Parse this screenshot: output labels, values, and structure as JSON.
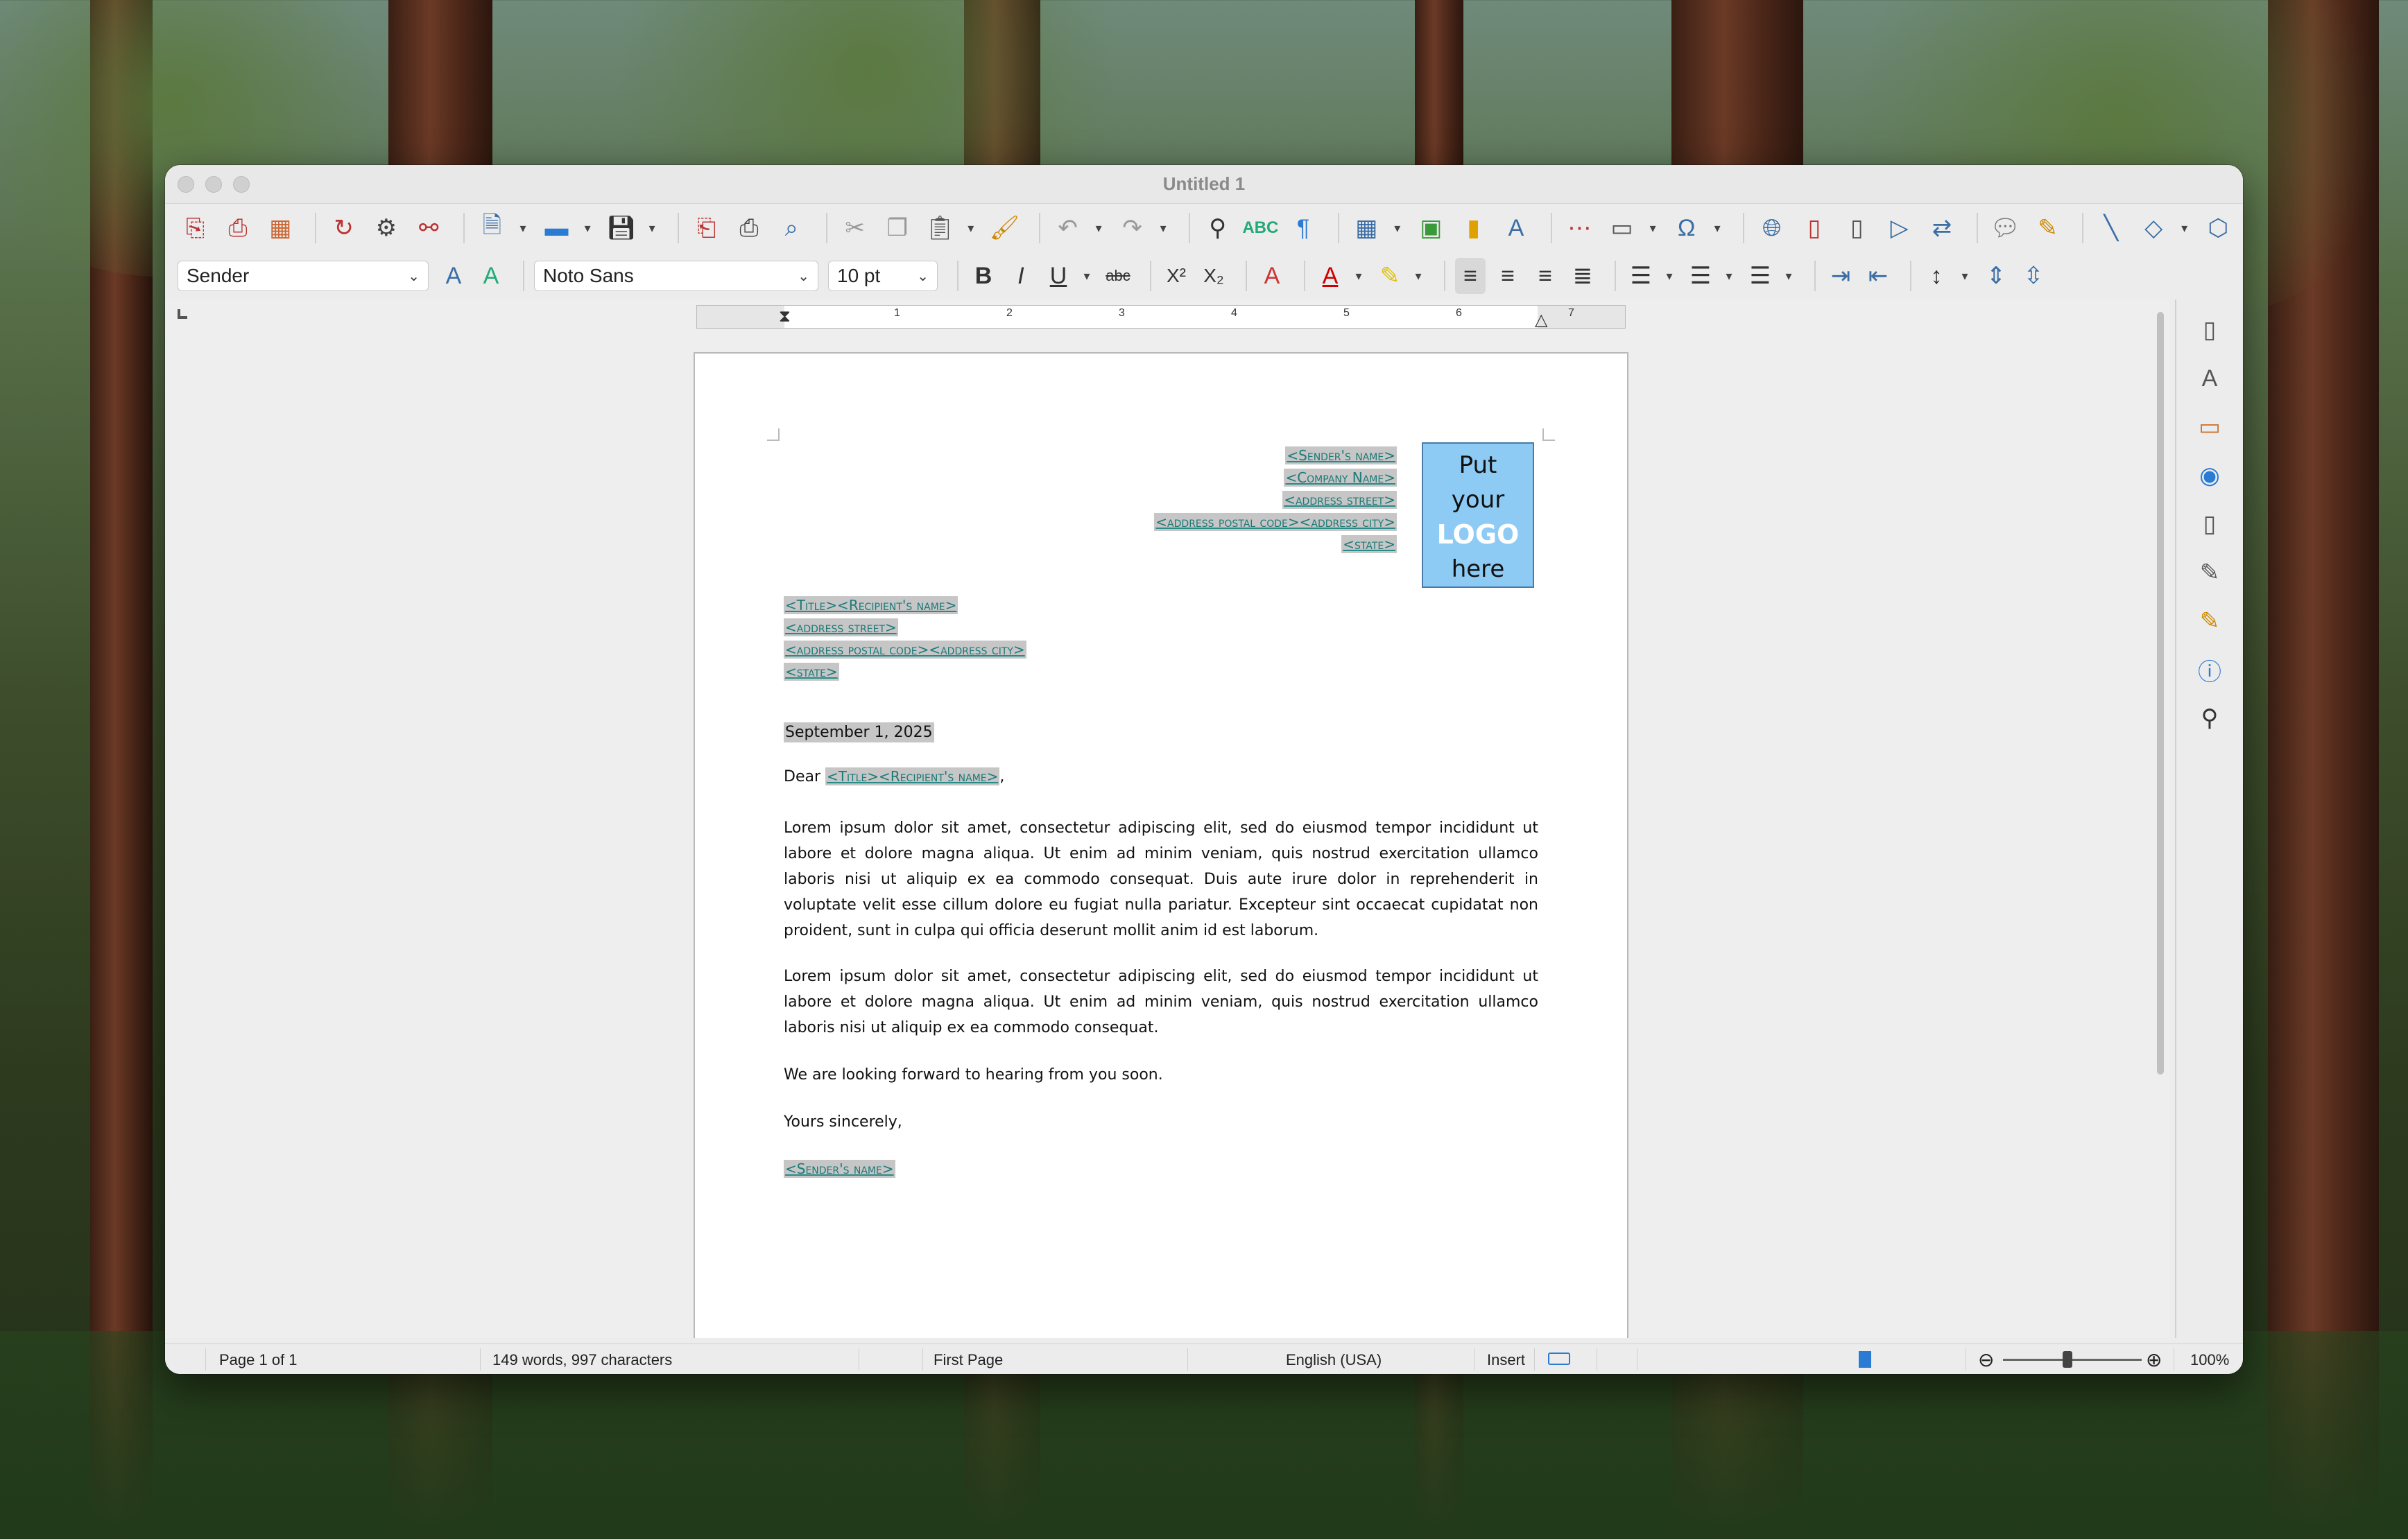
{
  "window": {
    "title": "Untitled 1"
  },
  "toolbar": {
    "paragraph_style": "Sender",
    "font_name": "Noto Sans",
    "font_size": "10 pt"
  },
  "ruler": {
    "numbers": [
      "1",
      "2",
      "3",
      "4",
      "5",
      "6",
      "7"
    ]
  },
  "document": {
    "sender_fields": [
      "<Sender's name>",
      "<Company Name>",
      "<address street>",
      "<address postal code><address city>",
      "<state>"
    ],
    "logo_lines": [
      "Put",
      "your",
      "LOGO",
      "here"
    ],
    "recipient_fields": [
      "<Title><Recipient's name>",
      "<address street>",
      "<address postal code><address city>",
      "<state>"
    ],
    "date": "September 1, 2025",
    "salutation_prefix": "Dear ",
    "salutation_field": "<Title><Recipient's name>",
    "salutation_suffix": ",",
    "paragraph1": "Lorem ipsum dolor sit amet, consectetur adipiscing elit, sed do eiusmod tempor incididunt ut labore et dolore magna aliqua. Ut enim ad minim veniam, quis nostrud exercitation ullamco laboris nisi ut aliquip ex ea commodo consequat. Duis aute irure dolor in reprehenderit in voluptate velit esse cillum dolore eu fugiat nulla pariatur. Excepteur sint occaecat cupidatat non proident, sunt in culpa qui officia deserunt mollit anim id est laborum.",
    "paragraph2": "Lorem ipsum dolor sit amet, consectetur adipiscing elit, sed do eiusmod tempor incididunt ut labore et dolore magna aliqua. Ut enim ad minim veniam, quis nostrud exercitation ullamco laboris nisi ut aliquip ex ea commodo consequat.",
    "closing_line": "We are looking forward to hearing from you soon.",
    "signoff": "Yours sincerely,",
    "signature_field": "<Sender's name>"
  },
  "statusbar": {
    "page": "Page 1 of 1",
    "word_count": "149 words, 997 characters",
    "page_style": "First Page",
    "language": "English (USA)",
    "insert_mode": "Insert",
    "zoom": "100%"
  }
}
